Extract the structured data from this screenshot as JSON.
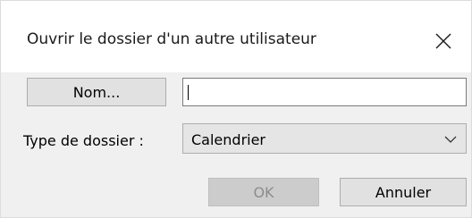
{
  "dialog": {
    "title": "Ouvrir le dossier d'un autre utilisateur",
    "close_icon": "close-icon"
  },
  "form": {
    "name_button_label": "Nom...",
    "name_input_value": "",
    "folder_type_label": "Type de dossier :",
    "folder_type_selected": "Calendrier",
    "dropdown_icon": "chevron-down-icon"
  },
  "actions": {
    "ok_label": "OK",
    "ok_enabled": false,
    "cancel_label": "Annuler"
  }
}
